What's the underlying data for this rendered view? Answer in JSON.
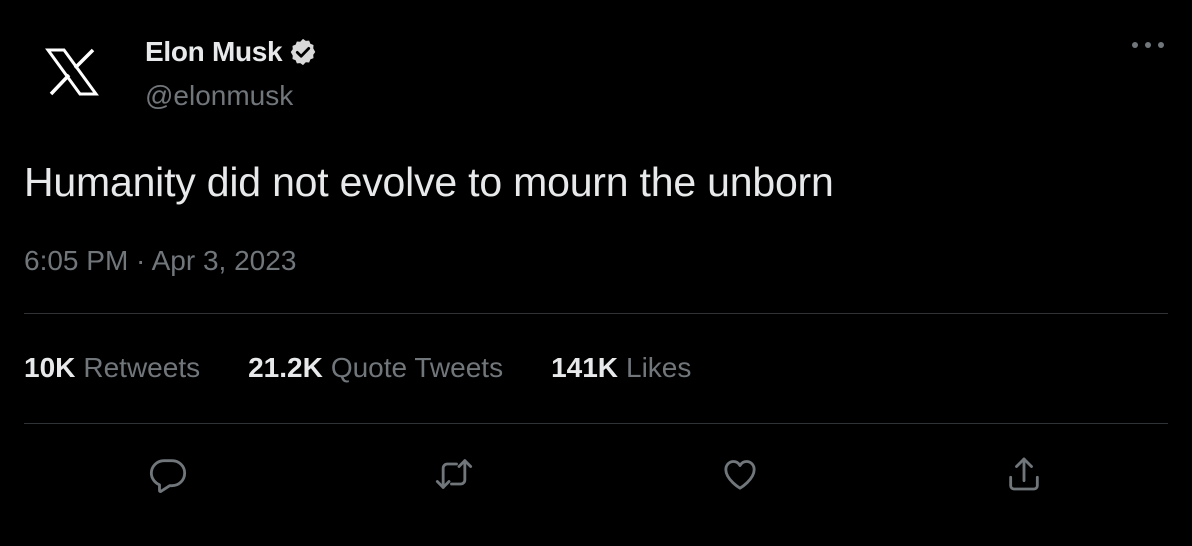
{
  "author": {
    "display_name": "Elon Musk",
    "handle": "@elonmusk",
    "avatar_icon": "x-logo-icon",
    "verified_icon": "verified-badge-icon"
  },
  "tweet": {
    "text": "Humanity did not evolve to mourn the unborn",
    "timestamp": "6:05 PM · Apr 3, 2023"
  },
  "stats": {
    "retweets_count": "10K",
    "retweets_label": "Retweets",
    "quotes_count": "21.2K",
    "quotes_label": "Quote Tweets",
    "likes_count": "141K",
    "likes_label": "Likes"
  },
  "actions": [
    {
      "icon": "reply-icon"
    },
    {
      "icon": "retweet-icon"
    },
    {
      "icon": "like-icon"
    },
    {
      "icon": "share-icon"
    }
  ],
  "colors": {
    "background": "#000000",
    "primary_text": "#e7e9ea",
    "secondary_text": "#71767b",
    "divider": "#2f3336"
  }
}
